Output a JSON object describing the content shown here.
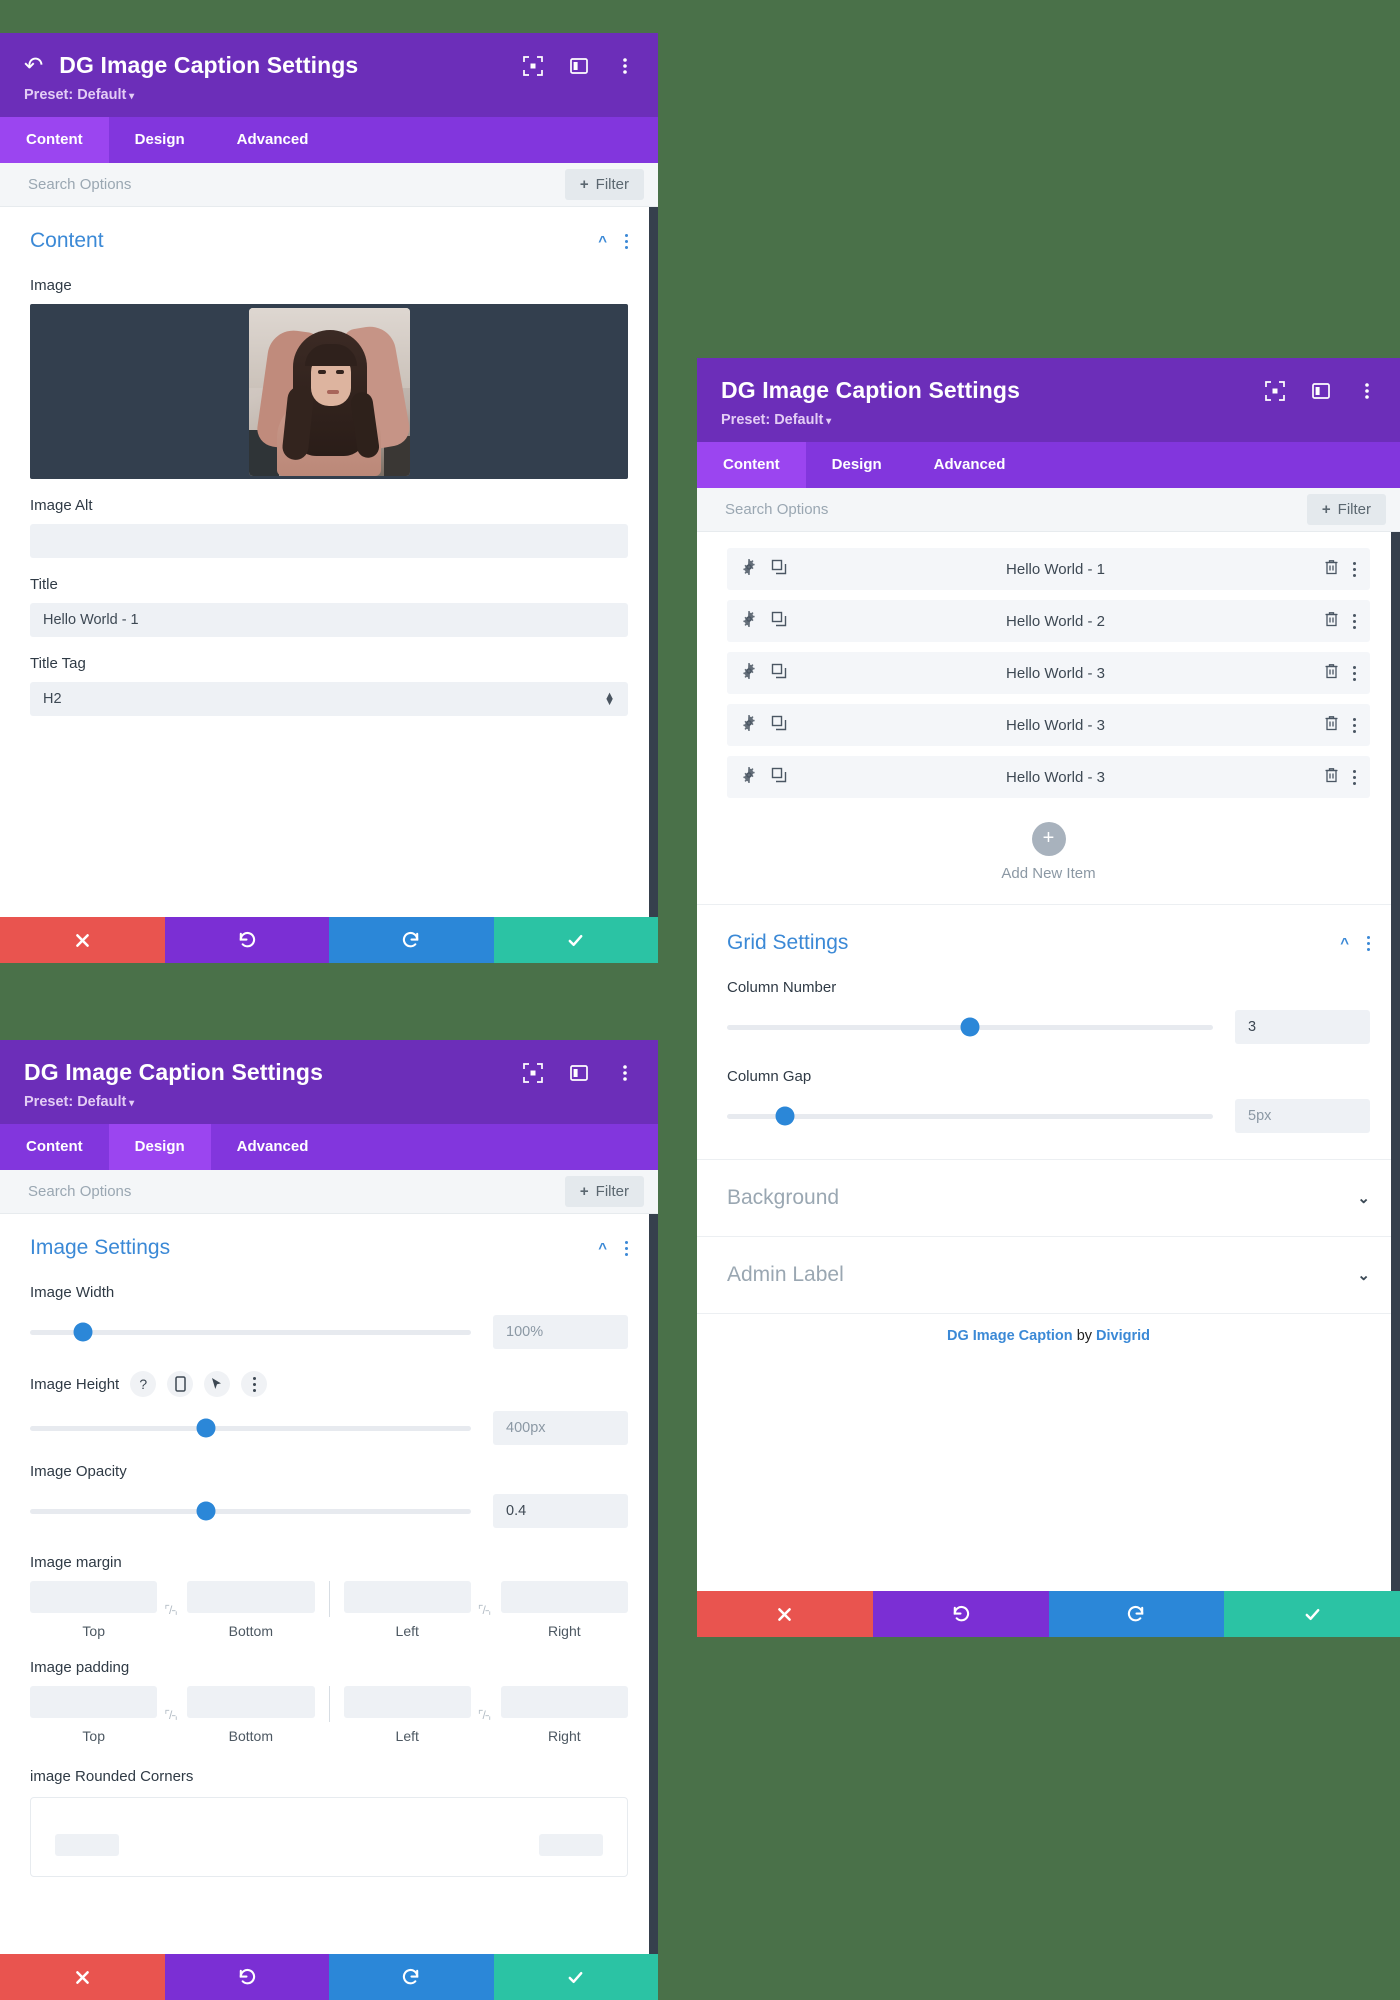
{
  "background_color": "#4a7149",
  "panels": {
    "content": {
      "title": "DG Image Caption Settings",
      "preset": "Preset: Default",
      "back_icon": "back-arrow-icon",
      "tabs": [
        {
          "label": "Content",
          "active": true
        },
        {
          "label": "Design",
          "active": false
        },
        {
          "label": "Advanced",
          "active": false
        }
      ],
      "search_placeholder": "Search Options",
      "filter_label": "Filter",
      "section": {
        "title": "Content",
        "fields": {
          "image_label": "Image",
          "image_alt_label": "Image Alt",
          "image_alt_value": "",
          "title_label": "Title",
          "title_value": "Hello World - 1",
          "title_tag_label": "Title Tag",
          "title_tag_value": "H2"
        }
      }
    },
    "design": {
      "title": "DG Image Caption Settings",
      "preset": "Preset: Default",
      "tabs": [
        {
          "label": "Content",
          "active": false
        },
        {
          "label": "Design",
          "active": true
        },
        {
          "label": "Advanced",
          "active": false
        }
      ],
      "search_placeholder": "Search Options",
      "filter_label": "Filter",
      "section": {
        "title": "Image Settings",
        "sliders": [
          {
            "label": "Image Width",
            "value": "100%",
            "percent": 12,
            "placeholder_style": true
          },
          {
            "label": "Image Height",
            "value": "400px",
            "percent": 40,
            "placeholder_style": true,
            "hover_icons": [
              "help-icon",
              "mobile-icon",
              "cursor-icon",
              "kebab-icon"
            ]
          },
          {
            "label": "Image Opacity",
            "value": "0.4",
            "percent": 40,
            "placeholder_style": false
          }
        ],
        "spacing": [
          {
            "label": "Image margin",
            "cells": [
              "Top",
              "Bottom",
              "Left",
              "Right"
            ]
          },
          {
            "label": "Image padding",
            "cells": [
              "Top",
              "Bottom",
              "Left",
              "Right"
            ]
          }
        ],
        "rounded_corners_label": "image Rounded Corners"
      }
    },
    "list": {
      "title": "DG Image Caption Settings",
      "preset": "Preset: Default",
      "tabs": [
        {
          "label": "Content",
          "active": true
        },
        {
          "label": "Design",
          "active": false
        },
        {
          "label": "Advanced",
          "active": false
        }
      ],
      "search_placeholder": "Search Options",
      "filter_label": "Filter",
      "items": [
        {
          "name": "Hello World - 1"
        },
        {
          "name": "Hello World - 2"
        },
        {
          "name": "Hello World - 3"
        },
        {
          "name": "Hello World - 3"
        },
        {
          "name": "Hello World - 3"
        }
      ],
      "add_new_label": "Add New Item",
      "grid_settings": {
        "title": "Grid Settings",
        "column_number_label": "Column Number",
        "column_number_value": "3",
        "column_number_percent": 50,
        "column_gap_label": "Column Gap",
        "column_gap_value": "5px",
        "column_gap_percent": 12
      },
      "collapsed_sections": [
        {
          "label": "Background"
        },
        {
          "label": "Admin Label"
        }
      ],
      "branding": {
        "product": "DG Image Caption",
        "by": "by",
        "vendor": "Divigrid"
      }
    }
  },
  "footer_buttons": [
    {
      "name": "cancel",
      "icon": "close-icon",
      "color": "#e9544f"
    },
    {
      "name": "undo",
      "icon": "undo-icon",
      "color": "#7b2fd4"
    },
    {
      "name": "redo",
      "icon": "redo-icon",
      "color": "#2b87d8"
    },
    {
      "name": "save",
      "icon": "check-icon",
      "color": "#2bc3a4"
    }
  ],
  "header_icons": [
    "expand-icon",
    "layout-icon",
    "kebab-icon"
  ]
}
